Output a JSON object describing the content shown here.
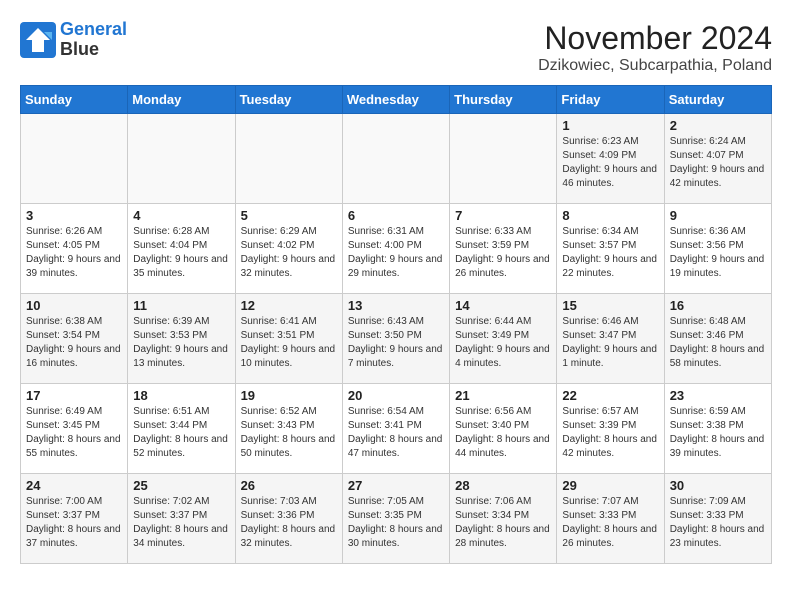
{
  "header": {
    "logo_line1": "General",
    "logo_line2": "Blue",
    "month": "November 2024",
    "location": "Dzikowiec, Subcarpathia, Poland"
  },
  "weekdays": [
    "Sunday",
    "Monday",
    "Tuesday",
    "Wednesday",
    "Thursday",
    "Friday",
    "Saturday"
  ],
  "weeks": [
    [
      {
        "day": "",
        "info": ""
      },
      {
        "day": "",
        "info": ""
      },
      {
        "day": "",
        "info": ""
      },
      {
        "day": "",
        "info": ""
      },
      {
        "day": "",
        "info": ""
      },
      {
        "day": "1",
        "info": "Sunrise: 6:23 AM\nSunset: 4:09 PM\nDaylight: 9 hours and 46 minutes."
      },
      {
        "day": "2",
        "info": "Sunrise: 6:24 AM\nSunset: 4:07 PM\nDaylight: 9 hours and 42 minutes."
      }
    ],
    [
      {
        "day": "3",
        "info": "Sunrise: 6:26 AM\nSunset: 4:05 PM\nDaylight: 9 hours and 39 minutes."
      },
      {
        "day": "4",
        "info": "Sunrise: 6:28 AM\nSunset: 4:04 PM\nDaylight: 9 hours and 35 minutes."
      },
      {
        "day": "5",
        "info": "Sunrise: 6:29 AM\nSunset: 4:02 PM\nDaylight: 9 hours and 32 minutes."
      },
      {
        "day": "6",
        "info": "Sunrise: 6:31 AM\nSunset: 4:00 PM\nDaylight: 9 hours and 29 minutes."
      },
      {
        "day": "7",
        "info": "Sunrise: 6:33 AM\nSunset: 3:59 PM\nDaylight: 9 hours and 26 minutes."
      },
      {
        "day": "8",
        "info": "Sunrise: 6:34 AM\nSunset: 3:57 PM\nDaylight: 9 hours and 22 minutes."
      },
      {
        "day": "9",
        "info": "Sunrise: 6:36 AM\nSunset: 3:56 PM\nDaylight: 9 hours and 19 minutes."
      }
    ],
    [
      {
        "day": "10",
        "info": "Sunrise: 6:38 AM\nSunset: 3:54 PM\nDaylight: 9 hours and 16 minutes."
      },
      {
        "day": "11",
        "info": "Sunrise: 6:39 AM\nSunset: 3:53 PM\nDaylight: 9 hours and 13 minutes."
      },
      {
        "day": "12",
        "info": "Sunrise: 6:41 AM\nSunset: 3:51 PM\nDaylight: 9 hours and 10 minutes."
      },
      {
        "day": "13",
        "info": "Sunrise: 6:43 AM\nSunset: 3:50 PM\nDaylight: 9 hours and 7 minutes."
      },
      {
        "day": "14",
        "info": "Sunrise: 6:44 AM\nSunset: 3:49 PM\nDaylight: 9 hours and 4 minutes."
      },
      {
        "day": "15",
        "info": "Sunrise: 6:46 AM\nSunset: 3:47 PM\nDaylight: 9 hours and 1 minute."
      },
      {
        "day": "16",
        "info": "Sunrise: 6:48 AM\nSunset: 3:46 PM\nDaylight: 8 hours and 58 minutes."
      }
    ],
    [
      {
        "day": "17",
        "info": "Sunrise: 6:49 AM\nSunset: 3:45 PM\nDaylight: 8 hours and 55 minutes."
      },
      {
        "day": "18",
        "info": "Sunrise: 6:51 AM\nSunset: 3:44 PM\nDaylight: 8 hours and 52 minutes."
      },
      {
        "day": "19",
        "info": "Sunrise: 6:52 AM\nSunset: 3:43 PM\nDaylight: 8 hours and 50 minutes."
      },
      {
        "day": "20",
        "info": "Sunrise: 6:54 AM\nSunset: 3:41 PM\nDaylight: 8 hours and 47 minutes."
      },
      {
        "day": "21",
        "info": "Sunrise: 6:56 AM\nSunset: 3:40 PM\nDaylight: 8 hours and 44 minutes."
      },
      {
        "day": "22",
        "info": "Sunrise: 6:57 AM\nSunset: 3:39 PM\nDaylight: 8 hours and 42 minutes."
      },
      {
        "day": "23",
        "info": "Sunrise: 6:59 AM\nSunset: 3:38 PM\nDaylight: 8 hours and 39 minutes."
      }
    ],
    [
      {
        "day": "24",
        "info": "Sunrise: 7:00 AM\nSunset: 3:37 PM\nDaylight: 8 hours and 37 minutes."
      },
      {
        "day": "25",
        "info": "Sunrise: 7:02 AM\nSunset: 3:37 PM\nDaylight: 8 hours and 34 minutes."
      },
      {
        "day": "26",
        "info": "Sunrise: 7:03 AM\nSunset: 3:36 PM\nDaylight: 8 hours and 32 minutes."
      },
      {
        "day": "27",
        "info": "Sunrise: 7:05 AM\nSunset: 3:35 PM\nDaylight: 8 hours and 30 minutes."
      },
      {
        "day": "28",
        "info": "Sunrise: 7:06 AM\nSunset: 3:34 PM\nDaylight: 8 hours and 28 minutes."
      },
      {
        "day": "29",
        "info": "Sunrise: 7:07 AM\nSunset: 3:33 PM\nDaylight: 8 hours and 26 minutes."
      },
      {
        "day": "30",
        "info": "Sunrise: 7:09 AM\nSunset: 3:33 PM\nDaylight: 8 hours and 23 minutes."
      }
    ]
  ]
}
